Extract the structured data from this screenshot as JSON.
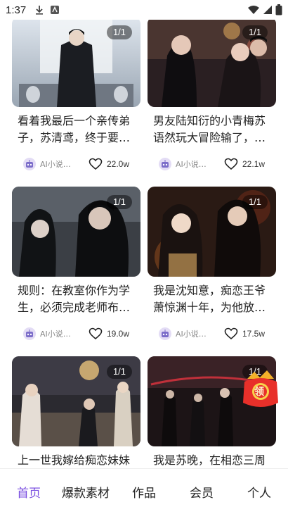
{
  "status": {
    "time": "1:37"
  },
  "cards": [
    {
      "badge": "1/1",
      "title": "看着我最后一个亲传弟子，苏清鸢，终于要…",
      "author": "AI小说…",
      "likes": "22.0w"
    },
    {
      "badge": "1/1",
      "title": "男友陆知衍的小青梅苏语然玩大冒险输了，…",
      "author": "AI小说…",
      "likes": "22.1w"
    },
    {
      "badge": "1/1",
      "title": "规则：在教室你作为学生，必须完成老师布…",
      "author": "AI小说…",
      "likes": "19.0w"
    },
    {
      "badge": "1/1",
      "title": "我是沈知意，痴恋王爷萧惊渊十年，为他放…",
      "author": "AI小说…",
      "likes": "17.5w"
    },
    {
      "badge": "1/1",
      "title": "上一世我嫁给痴恋妹妹",
      "author": "",
      "likes": ""
    },
    {
      "badge": "1/1",
      "title": "我是苏晚，在相恋三周",
      "author": "",
      "likes": ""
    }
  ],
  "gift": {
    "label": "领"
  },
  "tabs": [
    {
      "label": "首页",
      "active": true
    },
    {
      "label": "爆款素材",
      "active": false
    },
    {
      "label": "作品",
      "active": false
    },
    {
      "label": "会员",
      "active": false
    },
    {
      "label": "个人",
      "active": false
    }
  ],
  "colors": {
    "accent": "#7b4fe0",
    "text": "#222222",
    "muted": "#888888"
  },
  "icons": {
    "like": "heart-icon",
    "avatar": "robot-avatar-icon",
    "download": "download-icon",
    "notify": "app-notification-icon",
    "wifi": "wifi-icon",
    "signal": "signal-icon",
    "battery": "battery-icon"
  }
}
